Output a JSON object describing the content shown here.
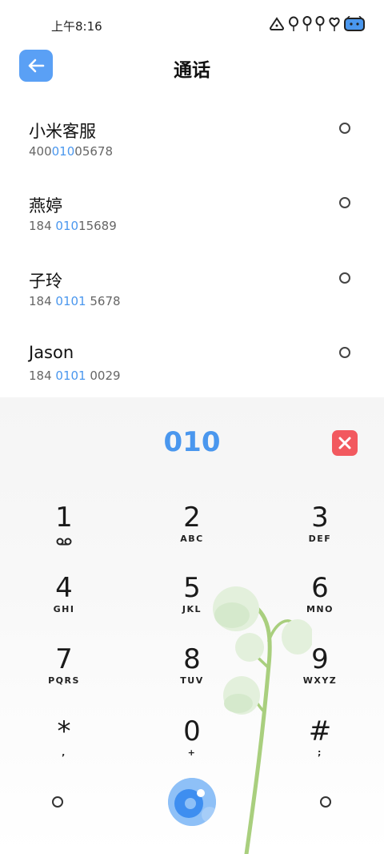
{
  "status_bar": {
    "time": "上午8:16"
  },
  "header": {
    "title": "通话"
  },
  "contacts": [
    {
      "name": "小米客服",
      "number_pre": "400",
      "number_hl": "010",
      "number_post": "05678"
    },
    {
      "name": "燕婷",
      "number_pre": "184 ",
      "number_hl": "010",
      "number_post": "15689"
    },
    {
      "name": "子玲",
      "number_pre": "184 ",
      "number_hl": "0101",
      "number_post": " 5678"
    },
    {
      "name": "Jason",
      "number_pre": "184 ",
      "number_hl": "0101",
      "number_post": " 0029"
    }
  ],
  "dialpad": {
    "input": "010",
    "keys": [
      {
        "digit": "1",
        "letters": "",
        "icon": "voicemail-icon"
      },
      {
        "digit": "2",
        "letters": "ABC"
      },
      {
        "digit": "3",
        "letters": "DEF"
      },
      {
        "digit": "4",
        "letters": "GHI"
      },
      {
        "digit": "5",
        "letters": "JKL"
      },
      {
        "digit": "6",
        "letters": "MNO"
      },
      {
        "digit": "7",
        "letters": "PQRS"
      },
      {
        "digit": "8",
        "letters": "TUV"
      },
      {
        "digit": "9",
        "letters": "WXYZ"
      },
      {
        "digit": "*",
        "letters": ","
      },
      {
        "digit": "0",
        "letters": "+"
      },
      {
        "digit": "#",
        "letters": ";"
      }
    ]
  },
  "colors": {
    "accent": "#4a97ee",
    "delete": "#f2595f",
    "back_button": "#5aa0f5"
  }
}
